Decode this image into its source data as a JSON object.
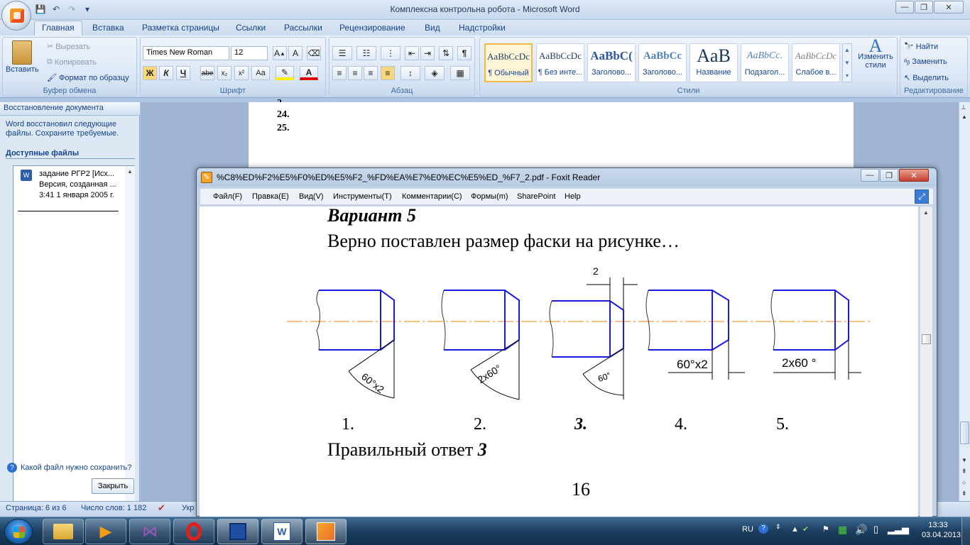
{
  "word": {
    "window_title": "Комплексна контрольна робота - Microsoft Word",
    "tabs": [
      "Главная",
      "Вставка",
      "Разметка страницы",
      "Ссылки",
      "Рассылки",
      "Рецензирование",
      "Вид",
      "Надстройки"
    ],
    "clipboard": {
      "paste": "Вставить",
      "cut": "Вырезать",
      "copy": "Копировать",
      "format_painter": "Формат по образцу",
      "label": "Буфер обмена"
    },
    "font": {
      "name": "Times New Roman",
      "size": "12",
      "label": "Шрифт",
      "bold": "Ж",
      "italic": "К",
      "underline": "Ч",
      "strike": "abe",
      "sub": "x₂",
      "sup": "x²",
      "case": "Aa"
    },
    "paragraph": {
      "label": "Абзац"
    },
    "styles": {
      "label": "Стили",
      "items": [
        {
          "sample": "AaBbCcDc",
          "name": "¶ Обычный"
        },
        {
          "sample": "AaBbCcDc",
          "name": "¶ Без инте..."
        },
        {
          "sample": "AaBbC(",
          "name": "Заголово..."
        },
        {
          "sample": "AaBbCc",
          "name": "Заголово..."
        },
        {
          "sample": "AaB",
          "name": "Название"
        },
        {
          "sample": "AaBbCc.",
          "name": "Подзагол..."
        },
        {
          "sample": "AaBbCcDc",
          "name": "Слабое в..."
        }
      ],
      "change": "Изменить стили"
    },
    "editing": {
      "find": "Найти",
      "replace": "Заменить",
      "select": "Выделить",
      "label": "Редактирование"
    },
    "recovery": {
      "header": "Восстановление документа",
      "message": "Word восстановил следующие файлы.  Сохраните требуемые.",
      "available": "Доступные файлы",
      "file_name": "задание РГР2  [Исх...",
      "file_ver": "Версия, созданная ...",
      "file_time": "3:41 1 января 2005 г.",
      "help": "Какой файл нужно сохранить?",
      "close": "Закрыть"
    },
    "doc_lines": [
      "24.",
      "25."
    ],
    "status": {
      "page": "Страница: 6 из 6",
      "words": "Число слов: 1 182",
      "lang": "Укр"
    }
  },
  "foxit": {
    "title": "%C8%ED%F2%E5%F0%ED%E5%F2_%FD%EA%E7%E0%EC%E5%ED_%F7_2.pdf - Foxit Reader",
    "menu": [
      "Файл(F)",
      "Правка(E)",
      "Вид(V)",
      "Инструменты(T)",
      "Комментарии(C)",
      "Формы(m)",
      "SharePoint",
      "Help"
    ],
    "variant": "Вариант 5",
    "question": "Верно поставлен размер фаски на рисунке…",
    "labels": {
      "a": "60°x2",
      "b": "2x60°",
      "c": "60°",
      "d": "60°x2",
      "e": "2x60 °",
      "top": "2"
    },
    "numbers": [
      "1.",
      "2.",
      "3.",
      "4.",
      "5."
    ],
    "answer_prefix": "Правильный ответ ",
    "answer": "3",
    "page_number": "16"
  },
  "tray": {
    "lang": "RU",
    "time": "13:33",
    "date": "03.04.2013"
  }
}
